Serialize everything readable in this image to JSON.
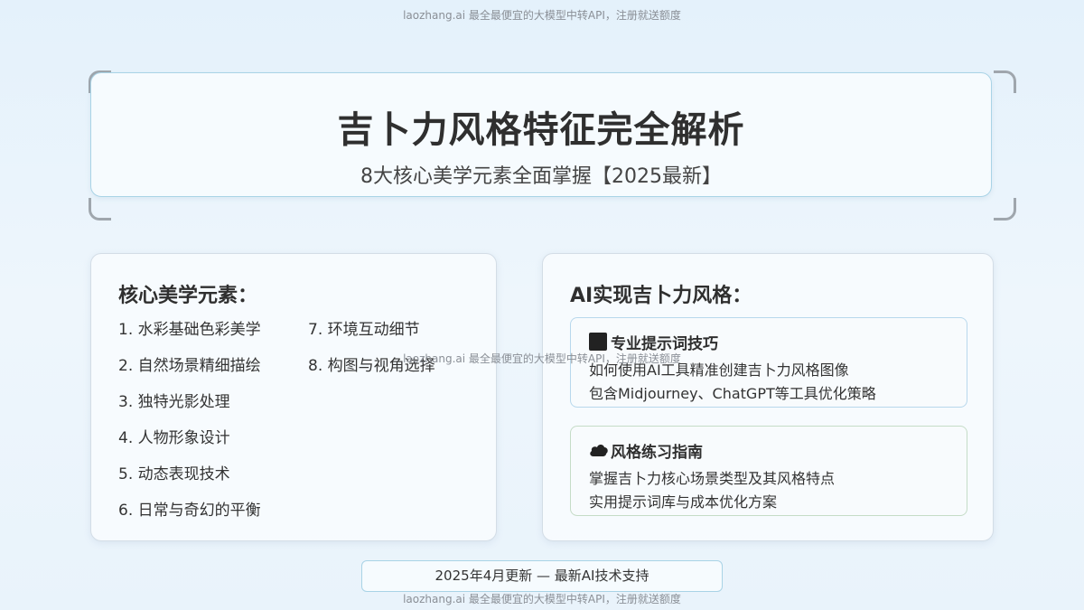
{
  "watermark": {
    "text": "laozhang.ai 最全最便宜的大模型中转API，注册就送额度"
  },
  "header": {
    "title": "吉卜力风格特征完全解析",
    "subtitle": "8大核心美学元素全面掌握【2025最新】"
  },
  "left_panel": {
    "title": "核心美学元素：",
    "column_a": [
      "1. 水彩基础色彩美学",
      "2. 自然场景精细描绘",
      "3. 独特光影处理",
      "4. 人物形象设计",
      "5. 动态表现技术",
      "6. 日常与奇幻的平衡"
    ],
    "column_b": [
      "7. 环境互动细节",
      "8. 构图与视角选择"
    ]
  },
  "right_panel": {
    "title": "AI实现吉卜力风格：",
    "cards": [
      {
        "icon": "black-square-icon",
        "heading": "专业提示词技巧",
        "line1": "如何使用AI工具精准创建吉卜力风格图像",
        "line2": "包含Midjourney、ChatGPT等工具优化策略"
      },
      {
        "icon": "cloud-icon",
        "heading": "风格练习指南",
        "line1": "掌握吉卜力核心场景类型及其风格特点",
        "line2": "实用提示词库与成本优化方案"
      }
    ]
  },
  "footer": {
    "text": "2025年4月更新 — 最新AI技术支持"
  },
  "colors": {
    "background": "#e8f3fb",
    "card_border_blue": "#a9d3e6",
    "card_border_green": "#c5dcc7",
    "corner_brackets": "#9fa6ad"
  }
}
